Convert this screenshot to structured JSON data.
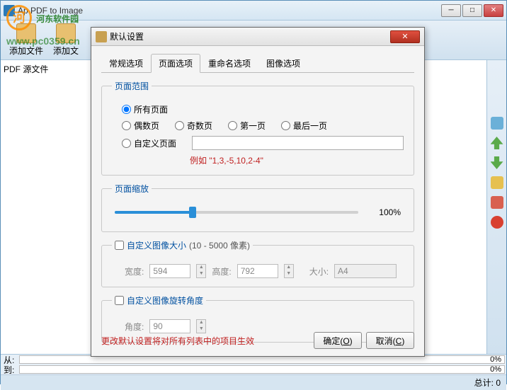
{
  "window": {
    "title": "Ap PDF to Image",
    "min": "─",
    "max": "□",
    "close": "✕"
  },
  "watermark": {
    "text": "河东软件园",
    "sub": "www.pc0359.cn"
  },
  "toolbar": {
    "add_file": "添加文件",
    "add_folder_trunc": "添加文"
  },
  "left_panel": {
    "header": "PDF 源文件"
  },
  "right_icons": {
    "refresh": "refresh",
    "up": "up",
    "down": "down",
    "edit": "edit",
    "delete": "delete",
    "remove": "remove"
  },
  "status": {
    "from": "从:",
    "to": "到:",
    "pct0": "0%",
    "total_label": "总计:",
    "total_val": "0"
  },
  "dialog": {
    "title": "默认设置",
    "close": "✕",
    "tabs": {
      "general": "常规选项",
      "page": "页面选项",
      "rename": "重命名选项",
      "image": "图像选项"
    },
    "page_range": {
      "legend": "页面范围",
      "all": "所有页面",
      "even": "偶数页",
      "odd": "奇数页",
      "first": "第一页",
      "last": "最后一页",
      "custom": "自定义页面",
      "custom_value": "",
      "example": "例如  \"1,3,-5,10,2-4\""
    },
    "zoom": {
      "legend": "页面缩放",
      "percent": 100,
      "display": "100%"
    },
    "custom_size": {
      "label": "自定义图像大小",
      "hint": "(10 - 5000 像素)",
      "width_label": "宽度:",
      "width": "594",
      "height_label": "高度:",
      "height": "792",
      "preset_label": "大小:",
      "preset": "A4"
    },
    "rotation": {
      "label": "自定义图像旋转角度",
      "angle_label": "角度:",
      "angle": "90"
    },
    "footer": {
      "warn": "更改默认设置将对所有列表中的项目生效",
      "ok": "确定(O)",
      "cancel": "取消(C)"
    }
  }
}
